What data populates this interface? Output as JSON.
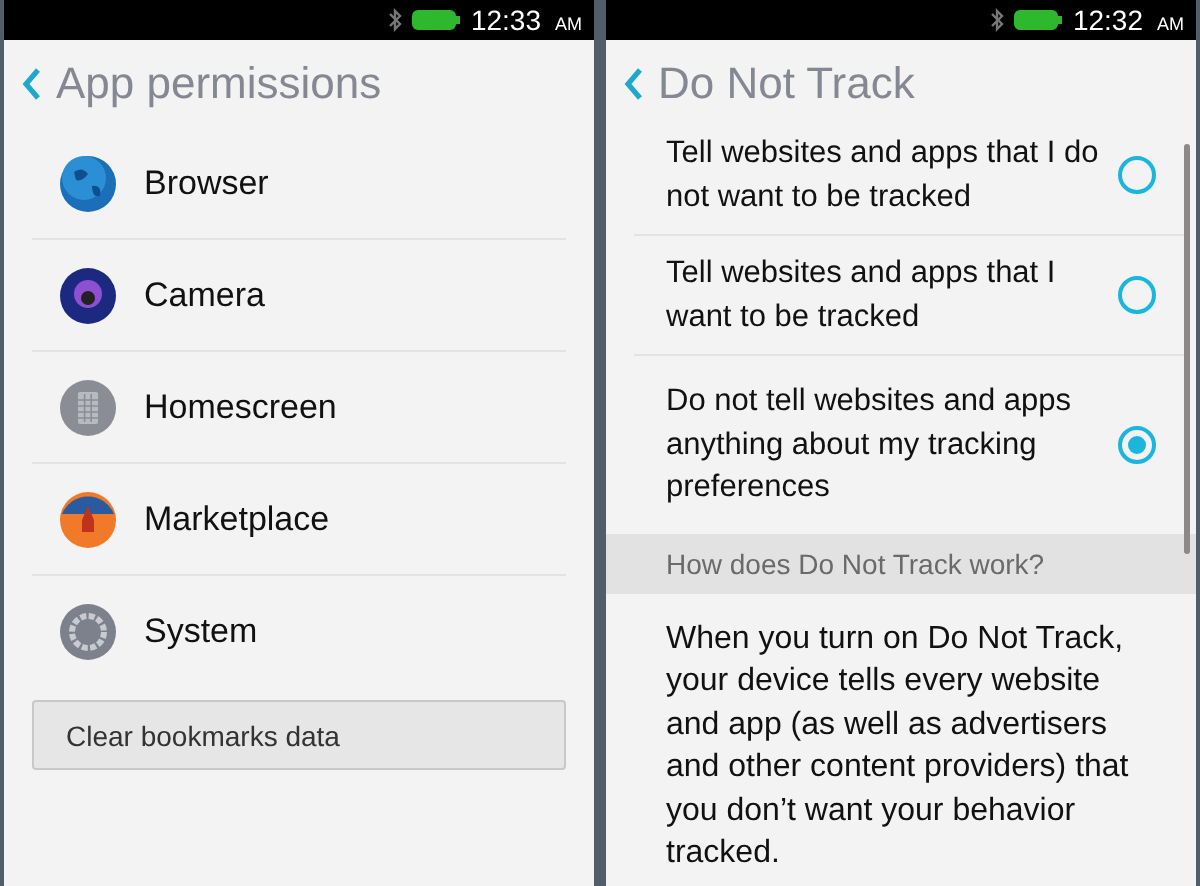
{
  "screens": [
    {
      "status_bar": {
        "time": "12:33",
        "meridiem": "AM"
      },
      "title": "App permissions",
      "apps": [
        {
          "name": "Browser",
          "kind": "globe"
        },
        {
          "name": "Camera",
          "kind": "camera"
        },
        {
          "name": "Homescreen",
          "kind": "grid"
        },
        {
          "name": "Marketplace",
          "kind": "rocket"
        },
        {
          "name": "System",
          "kind": "gear"
        }
      ],
      "button": "Clear bookmarks data"
    },
    {
      "status_bar": {
        "time": "12:32",
        "meridiem": "AM"
      },
      "title": "Do Not Track",
      "options": [
        {
          "label": "Tell websites and apps that I do not want to be tracked",
          "selected": false
        },
        {
          "label": "Tell websites and apps that I want to be tracked",
          "selected": false
        },
        {
          "label": "Do not tell websites and apps anything about my tracking preferences",
          "selected": true
        }
      ],
      "section_header": "How does Do Not Track work?",
      "description": "When you turn on Do Not Track, your device tells every website and app (as well as advertisers and other content providers) that you don’t want your behavior tracked."
    }
  ]
}
